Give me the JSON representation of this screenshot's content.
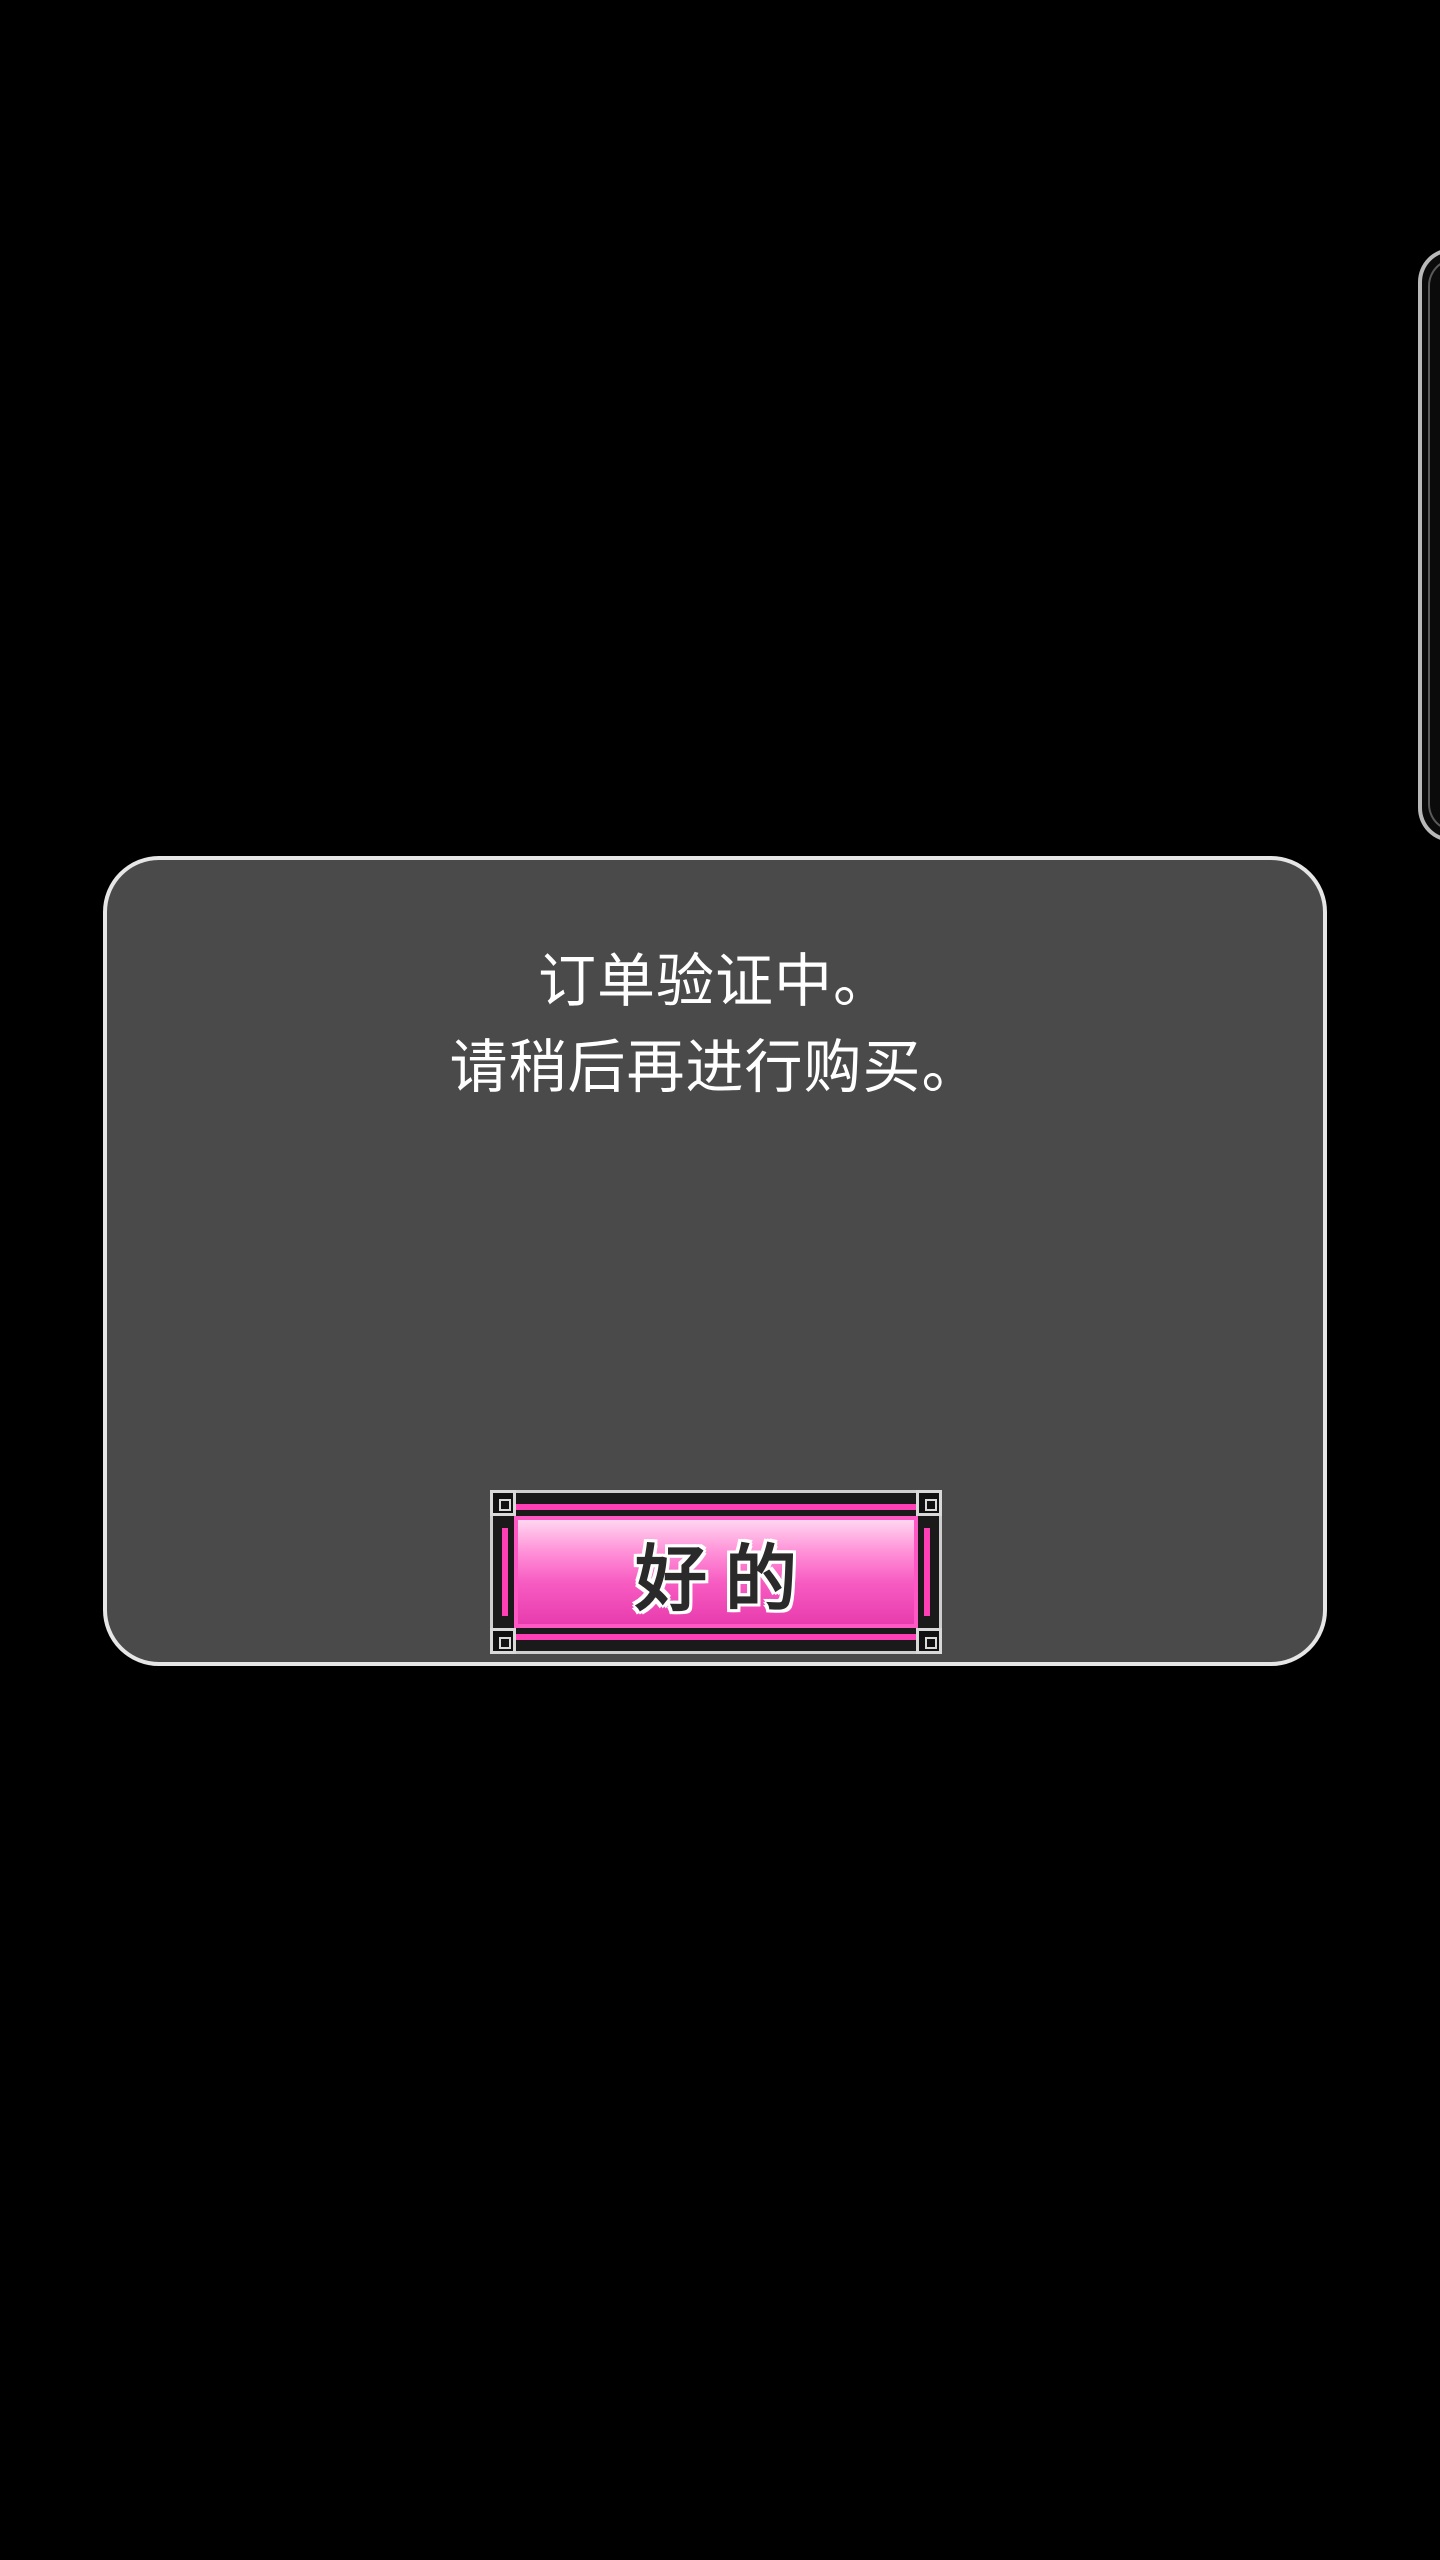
{
  "dialog": {
    "message_lines": [
      "订单验证中。",
      "请稍后再进行购买。"
    ],
    "ok_button_label": "好的"
  },
  "colors": {
    "background": "#000000",
    "dialog_fill": "#4a4a4a",
    "dialog_border": "#e6e6e6",
    "button_accent": "#ff3fb5"
  }
}
